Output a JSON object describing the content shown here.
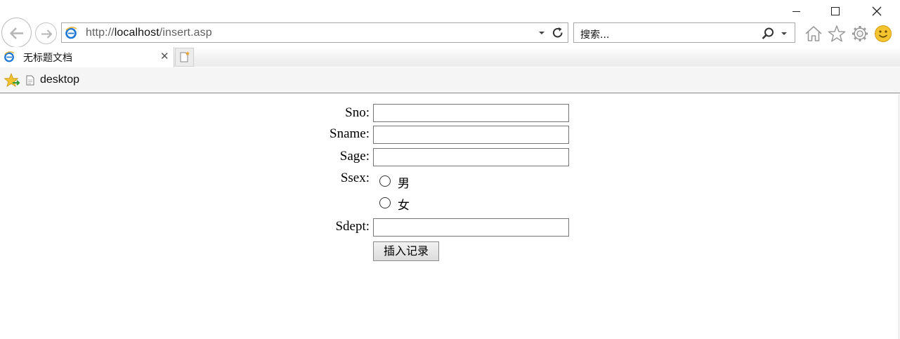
{
  "window": {
    "minimize_label": "",
    "maximize_label": "",
    "close_label": ""
  },
  "address_bar": {
    "url_prefix": "http://",
    "url_host": "localhost",
    "url_path": "/insert.asp"
  },
  "search_box": {
    "placeholder": "搜索..."
  },
  "tab": {
    "title": "无标题文档"
  },
  "favorites": {
    "items": [
      {
        "label": "desktop"
      }
    ]
  },
  "form": {
    "fields": [
      {
        "label": "Sno:"
      },
      {
        "label": "Sname:"
      },
      {
        "label": "Sage:"
      }
    ],
    "sex": {
      "label": "Ssex:",
      "options": [
        "男",
        "女"
      ]
    },
    "dept": {
      "label": "Sdept:"
    },
    "submit_label": "插入记录"
  }
}
